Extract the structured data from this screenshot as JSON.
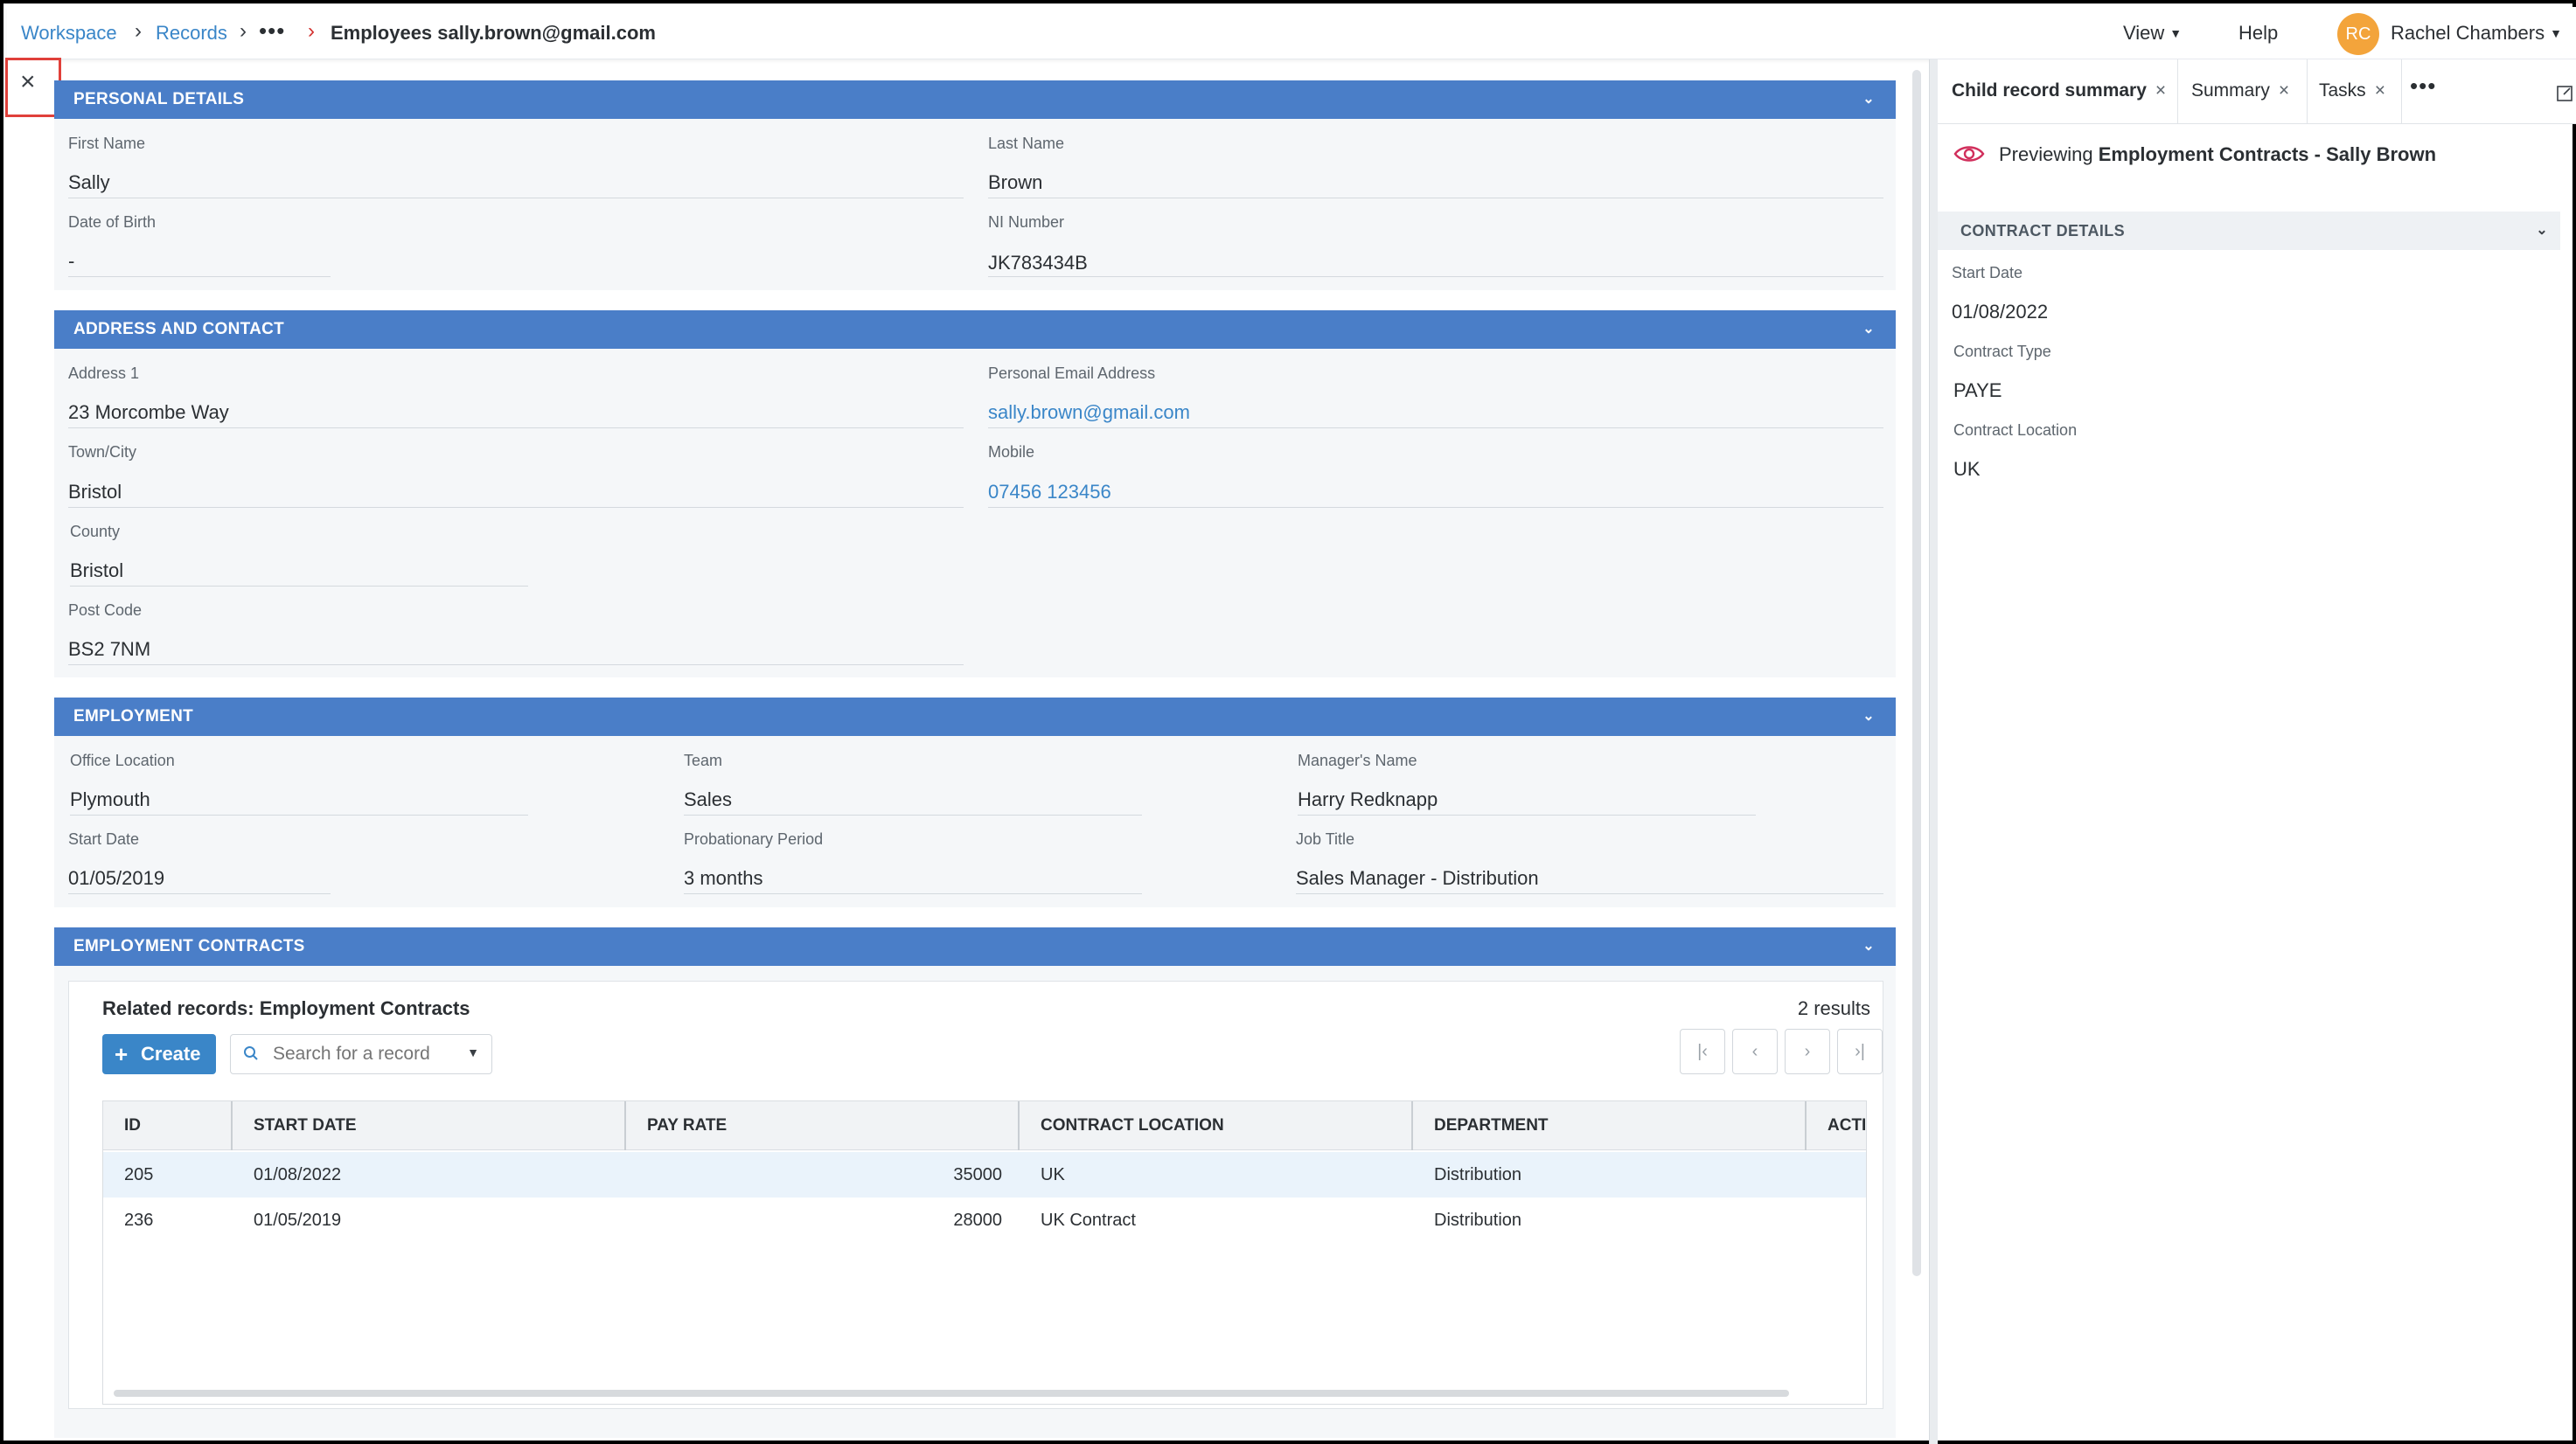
{
  "breadcrumb": {
    "workspace": "Workspace",
    "records": "Records",
    "more": "•••",
    "current": "Employees sally.brown@gmail.com"
  },
  "topnav": {
    "view": "View",
    "help": "Help",
    "user_initials": "RC",
    "user_name": "Rachel Chambers"
  },
  "close_label": "×",
  "sections": {
    "personal": {
      "title": "PERSONAL DETAILS",
      "first_name_label": "First Name",
      "first_name": "Sally",
      "last_name_label": "Last Name",
      "last_name": "Brown",
      "dob_label": "Date of Birth",
      "dob": "-",
      "ni_label": "NI Number",
      "ni": "JK783434B"
    },
    "address": {
      "title": "ADDRESS AND CONTACT",
      "address1_label": "Address 1",
      "address1": "23 Morcombe Way",
      "email_label": "Personal Email Address",
      "email": "sally.brown@gmail.com",
      "town_label": "Town/City",
      "town": "Bristol",
      "mobile_label": "Mobile",
      "mobile": "07456 123456",
      "county_label": "County",
      "county": "Bristol",
      "postcode_label": "Post Code",
      "postcode": "BS2 7NM"
    },
    "employment": {
      "title": "EMPLOYMENT",
      "office_label": "Office Location",
      "office": "Plymouth",
      "team_label": "Team",
      "team": "Sales",
      "manager_label": "Manager's Name",
      "manager": "Harry Redknapp",
      "start_label": "Start Date",
      "start": "01/05/2019",
      "probation_label": "Probationary Period",
      "probation": "3 months",
      "job_label": "Job Title",
      "job": "Sales Manager - Distribution"
    },
    "contracts": {
      "title": "EMPLOYMENT CONTRACTS",
      "related_title": "Related records: Employment Contracts",
      "results": "2 results",
      "create": "Create",
      "search_placeholder": "Search for a record",
      "pager": {
        "first": "|‹",
        "prev": "‹",
        "next": "›",
        "last": "›|"
      },
      "columns": [
        "ID",
        "START DATE",
        "PAY RATE",
        "CONTRACT LOCATION",
        "DEPARTMENT",
        "ACTI"
      ],
      "rows": [
        {
          "id": "205",
          "start": "01/08/2022",
          "pay": "35000",
          "location": "UK",
          "department": "Distribution"
        },
        {
          "id": "236",
          "start": "01/05/2019",
          "pay": "28000",
          "location": "UK Contract",
          "department": "Distribution"
        }
      ]
    }
  },
  "right_panel": {
    "tabs": [
      {
        "label": "Child record summary",
        "close": "×"
      },
      {
        "label": "Summary",
        "close": "×"
      },
      {
        "label": "Tasks",
        "close": "×"
      }
    ],
    "more": "•••",
    "preview_prefix": "Previewing ",
    "preview_name": "Employment Contracts - Sally Brown",
    "contract_details": {
      "title": "CONTRACT DETAILS",
      "start_label": "Start Date",
      "start": "01/08/2022",
      "type_label": "Contract Type",
      "type": "PAYE",
      "location_label": "Contract Location",
      "location": "UK"
    }
  },
  "colors": {
    "section_header": "#4a7ec8",
    "link": "#3a86c8",
    "avatar": "#f3a43b",
    "highlight": "#e0403a",
    "eye_icon": "#d12f5c"
  },
  "icons": [
    "close-icon",
    "chevron-right-icon",
    "chevron-down-icon",
    "search-icon",
    "plus-icon",
    "eye-icon",
    "expand-icon",
    "more-icon"
  ]
}
